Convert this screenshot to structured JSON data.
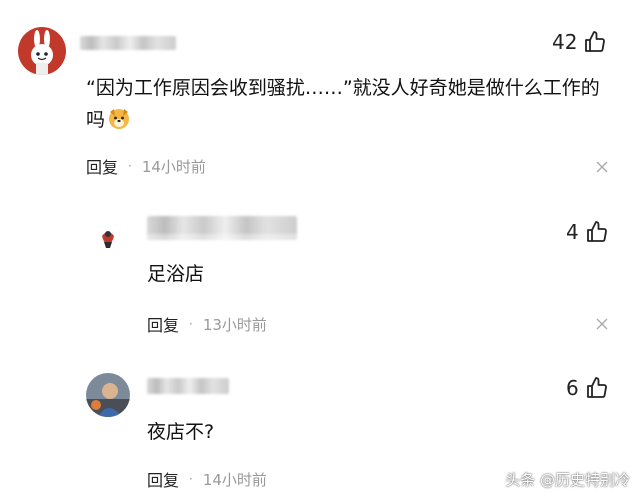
{
  "comment": {
    "likes": "42",
    "text": "“因为工作原因会收到骚扰……”就没人好奇她是做什么工作的吗",
    "reply_label": "回复",
    "dot": "·",
    "time": "14小时前"
  },
  "replies": [
    {
      "likes": "4",
      "text": "足浴店",
      "reply_label": "回复",
      "dot": "·",
      "time": "13小时前"
    },
    {
      "likes": "6",
      "text": "夜店不?",
      "reply_label": "回复",
      "dot": "·",
      "time": "14小时前"
    }
  ],
  "watermark": "头条 @历史特别冷",
  "icons": {
    "like": "thumbs-up-icon",
    "close": "close-icon",
    "emoji": "dog-face-emoji"
  },
  "colors": {
    "text": "#111111",
    "meta": "#999999",
    "background": "#ffffff"
  }
}
